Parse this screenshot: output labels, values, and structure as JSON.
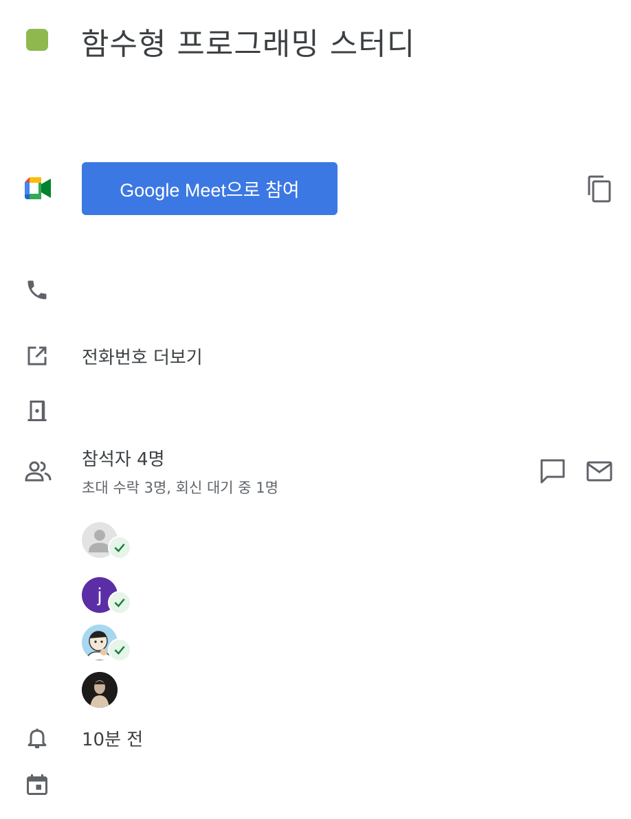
{
  "event": {
    "title": "함수형 프로그래밍 스터디",
    "color": "#8fb84f"
  },
  "meet": {
    "join_label": "Google Meet으로 참여",
    "button_color": "#3c78e3"
  },
  "phone": {
    "more_numbers_label": "전화번호 더보기"
  },
  "guests": {
    "count_label": "참석자 4명",
    "summary": "초대 수락 3명, 회신 대기 중 1명",
    "list": [
      {
        "type": "default",
        "accepted": true
      },
      {
        "type": "letter",
        "initial": "j",
        "color": "#5b2ea6",
        "accepted": true
      },
      {
        "type": "photo",
        "accepted": true
      },
      {
        "type": "photo-dark",
        "accepted": false
      }
    ]
  },
  "reminder": {
    "label": "10분 전"
  },
  "icons": {
    "meet": "google-meet-icon",
    "copy": "copy-icon",
    "phone": "phone-icon",
    "open_external": "open-in-new-icon",
    "room": "door-icon",
    "people": "people-icon",
    "chat": "chat-icon",
    "email": "mail-icon",
    "bell": "bell-icon",
    "calendar": "calendar-icon",
    "check": "check-icon"
  }
}
